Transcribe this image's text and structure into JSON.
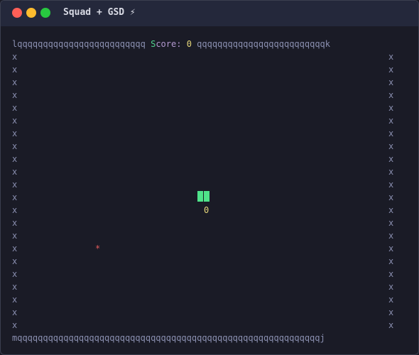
{
  "window": {
    "title": "Squad + GSD ⚡",
    "controls": {
      "close_color": "#ff5f57",
      "minimize_color": "#febc2e",
      "maximize_color": "#28c840"
    }
  },
  "game": {
    "border": {
      "top_left": "l",
      "top_right": "k",
      "bottom_left": "m",
      "bottom_right": "j",
      "horizontal_char": "q",
      "vertical_char": "x",
      "top_left_run": "qqqqqqqqqqqqqqqqqqqqqqqqq",
      "top_right_run": "qqqqqqqqqqqqqqqqqqqqqqqqq",
      "bottom_run": "qqqqqqqqqqqqqqqqqqqqqqqqqqqqqqqqqqqqqqqqqqqqqqqqqqqqqqqqqqq"
    },
    "score": {
      "label_first": "S",
      "label_rest": "core:",
      "value": "0"
    },
    "snake": {
      "player_label": "0"
    },
    "food": {
      "symbol": "*"
    }
  }
}
